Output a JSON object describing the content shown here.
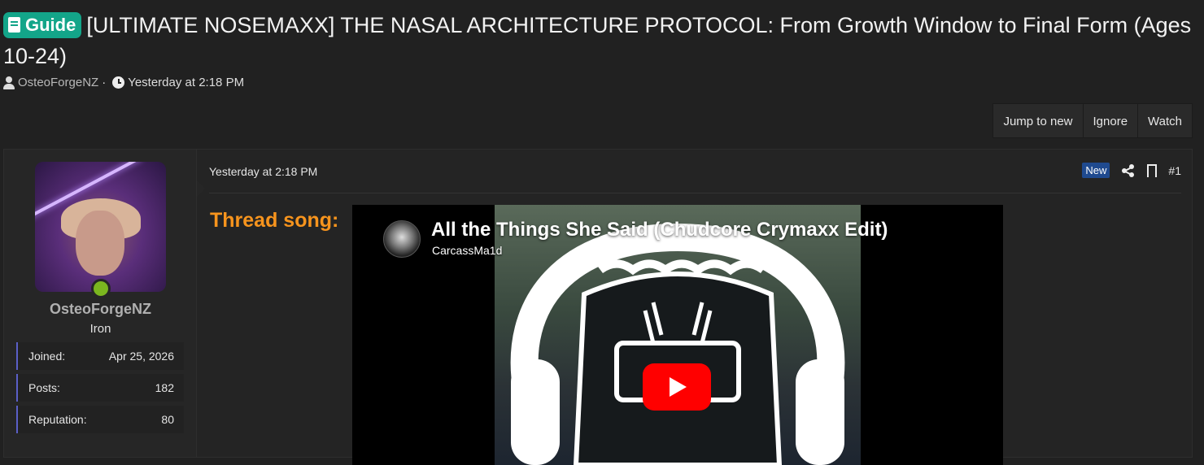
{
  "thread": {
    "prefix_label": "Guide",
    "title": "[ULTIMATE NOSEMAXX] THE NASAL ARCHITECTURE PROTOCOL: From Growth Window to Final Form (Ages 10-24)",
    "author": "OsteoForgeNZ",
    "separator": "·",
    "posted": "Yesterday at 2:18 PM"
  },
  "actions": {
    "jump_to_new": "Jump to new",
    "ignore": "Ignore",
    "watch": "Watch"
  },
  "post": {
    "user": {
      "name": "OsteoForgeNZ",
      "title": "Iron",
      "online": true,
      "stats": [
        {
          "label": "Joined:",
          "value": "Apr 25, 2026"
        },
        {
          "label": "Posts:",
          "value": "182"
        },
        {
          "label": "Reputation:",
          "value": "80"
        }
      ]
    },
    "date": "Yesterday at 2:18 PM",
    "new_badge": "New",
    "number": "#1",
    "heading": "Thread song:",
    "video": {
      "title": "All the Things She Said (Chudcore Crymaxx Edit)",
      "channel": "CarcassMa1d"
    }
  },
  "colors": {
    "guide_badge": "#13a589",
    "thread_song": "#f7941d",
    "online_dot": "#7bb61f",
    "new_badge": "#1f4a8f",
    "play_button": "#ff0000"
  },
  "icons": [
    "book-icon",
    "user-icon",
    "clock-icon",
    "share-icon",
    "bookmark-icon",
    "play-icon"
  ]
}
